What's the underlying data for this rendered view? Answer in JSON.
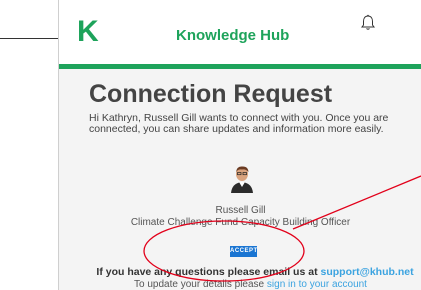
{
  "header": {
    "logo_letter": "K",
    "brand": "Knowledge Hub",
    "notification_icon": "bell-icon"
  },
  "email": {
    "title": "Connection Request",
    "intro": "Hi Kathryn, Russell Gill wants to connect with you. Once you are connected, you can share updates and information more easily.",
    "sender_name": "Russell Gill",
    "sender_role": "Climate Challenge Fund Capacity Building Officer",
    "accept_label": "ACCEPT",
    "questions_text": "If you have any questions please email us at ",
    "support_email": "support@khub.net",
    "update_prefix": "To update your details please ",
    "update_link": "sign in to your account"
  },
  "colors": {
    "brand_green": "#1ea35b",
    "accept_blue": "#1a75d2",
    "annotation_red": "#e2001a",
    "link_blue": "#3ba3e0"
  }
}
